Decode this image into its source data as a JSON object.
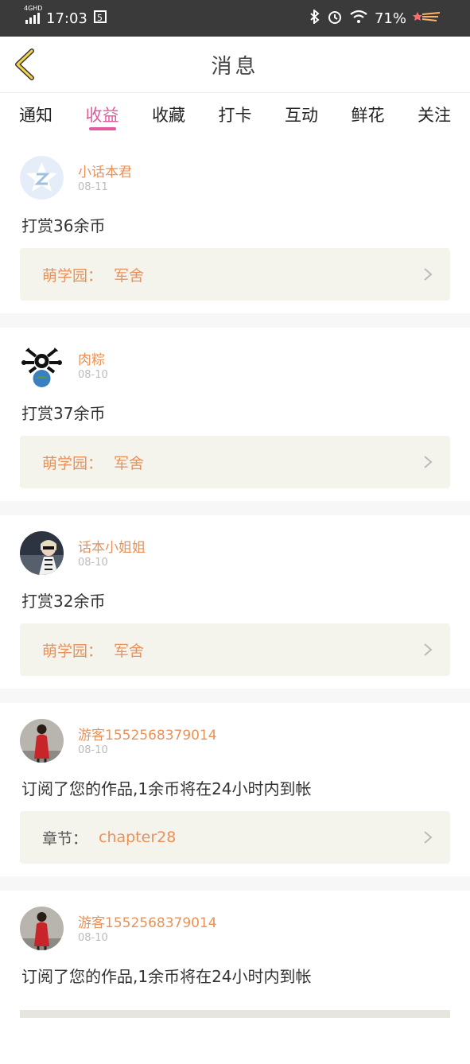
{
  "status": {
    "network": "4GHD",
    "time": "17:03",
    "battery": "71%"
  },
  "header": {
    "title": "消息"
  },
  "tabs": [
    {
      "label": "通知"
    },
    {
      "label": "收益"
    },
    {
      "label": "收藏"
    },
    {
      "label": "打卡"
    },
    {
      "label": "互动"
    },
    {
      "label": "鲜花"
    },
    {
      "label": "关注"
    }
  ],
  "active_tab": 1,
  "colors": {
    "accent": "#e05a9c",
    "name": "#e8925a",
    "panel_bg": "#f4f3ec"
  },
  "messages": [
    {
      "name": "小话本君",
      "date": "08-11",
      "text": "打赏36余币",
      "panel_label": "萌学园：",
      "panel_value": "军舍",
      "avatar": "z-logo"
    },
    {
      "name": "肉粽",
      "date": "08-10",
      "text": "打赏37余币",
      "panel_label": "萌学园：",
      "panel_value": "军舍",
      "avatar": "cartoon"
    },
    {
      "name": "话本小姐姐",
      "date": "08-10",
      "text": "打赏32余币",
      "panel_label": "萌学园：",
      "panel_value": "军舍",
      "avatar": "photo-girl"
    },
    {
      "name": "游客1552568379014",
      "date": "08-10",
      "text": "订阅了您的作品,1余币将在24小时内到帐",
      "panel_label": "章节：",
      "panel_value": "chapter28",
      "avatar": "photo-red"
    },
    {
      "name": "游客1552568379014",
      "date": "08-10",
      "text": "订阅了您的作品,1余币将在24小时内到帐",
      "panel_label": "",
      "panel_value": "",
      "avatar": "photo-red"
    }
  ]
}
